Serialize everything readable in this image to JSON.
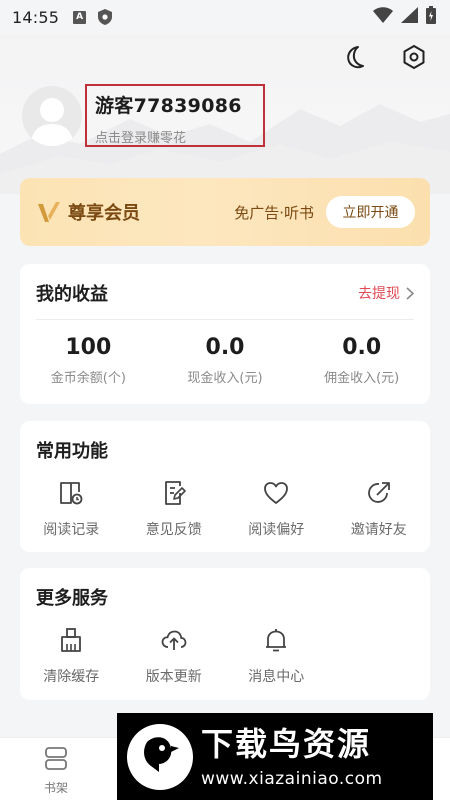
{
  "status": {
    "time": "14:55",
    "a_badge": "A"
  },
  "user": {
    "name": "游客77839086",
    "hint": "点击登录赚零花"
  },
  "vip": {
    "title": "尊享会员",
    "perks": "免广告·听书",
    "button": "立即开通"
  },
  "earnings": {
    "title": "我的收益",
    "withdraw": "去提现",
    "stats": [
      {
        "value": "100",
        "label": "金币余额(个)"
      },
      {
        "value": "0.0",
        "label": "现金收入(元)"
      },
      {
        "value": "0.0",
        "label": "佣金收入(元)"
      }
    ]
  },
  "common": {
    "title": "常用功能",
    "items": [
      {
        "label": "阅读记录",
        "icon": "reading-history-icon"
      },
      {
        "label": "意见反馈",
        "icon": "feedback-icon"
      },
      {
        "label": "阅读偏好",
        "icon": "heart-icon"
      },
      {
        "label": "邀请好友",
        "icon": "invite-icon"
      }
    ]
  },
  "more": {
    "title": "更多服务",
    "items": [
      {
        "label": "清除缓存",
        "icon": "broom-icon"
      },
      {
        "label": "版本更新",
        "icon": "cloud-upload-icon"
      },
      {
        "label": "消息中心",
        "icon": "bell-icon"
      }
    ]
  },
  "nav": {
    "items": [
      {
        "label": "书架",
        "icon": "bookshelf-icon"
      }
    ]
  },
  "watermark": {
    "title": "下载鸟资源",
    "url": "www.xiazainiao.com"
  },
  "colors": {
    "accent_red": "#e04a55",
    "vip_gold": "#7a4a12",
    "highlight_box": "#c0303a"
  }
}
